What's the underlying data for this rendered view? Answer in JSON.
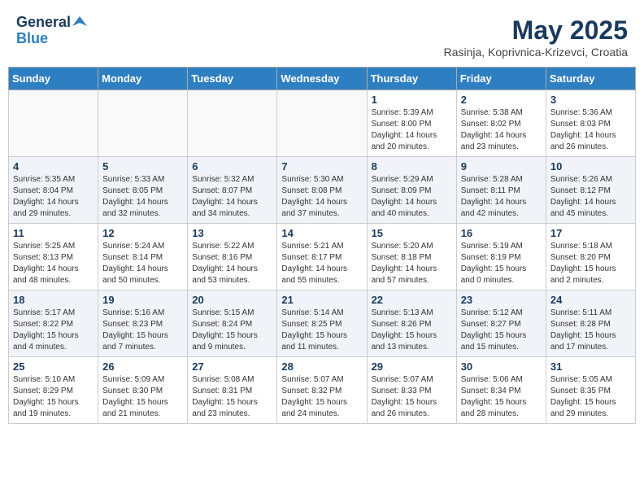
{
  "header": {
    "logo_general": "General",
    "logo_blue": "Blue",
    "month_title": "May 2025",
    "location": "Rasinja, Koprivnica-Krizevci, Croatia"
  },
  "weekdays": [
    "Sunday",
    "Monday",
    "Tuesday",
    "Wednesday",
    "Thursday",
    "Friday",
    "Saturday"
  ],
  "weeks": [
    [
      {
        "day": "",
        "info": ""
      },
      {
        "day": "",
        "info": ""
      },
      {
        "day": "",
        "info": ""
      },
      {
        "day": "",
        "info": ""
      },
      {
        "day": "1",
        "info": "Sunrise: 5:39 AM\nSunset: 8:00 PM\nDaylight: 14 hours\nand 20 minutes."
      },
      {
        "day": "2",
        "info": "Sunrise: 5:38 AM\nSunset: 8:02 PM\nDaylight: 14 hours\nand 23 minutes."
      },
      {
        "day": "3",
        "info": "Sunrise: 5:36 AM\nSunset: 8:03 PM\nDaylight: 14 hours\nand 26 minutes."
      }
    ],
    [
      {
        "day": "4",
        "info": "Sunrise: 5:35 AM\nSunset: 8:04 PM\nDaylight: 14 hours\nand 29 minutes."
      },
      {
        "day": "5",
        "info": "Sunrise: 5:33 AM\nSunset: 8:05 PM\nDaylight: 14 hours\nand 32 minutes."
      },
      {
        "day": "6",
        "info": "Sunrise: 5:32 AM\nSunset: 8:07 PM\nDaylight: 14 hours\nand 34 minutes."
      },
      {
        "day": "7",
        "info": "Sunrise: 5:30 AM\nSunset: 8:08 PM\nDaylight: 14 hours\nand 37 minutes."
      },
      {
        "day": "8",
        "info": "Sunrise: 5:29 AM\nSunset: 8:09 PM\nDaylight: 14 hours\nand 40 minutes."
      },
      {
        "day": "9",
        "info": "Sunrise: 5:28 AM\nSunset: 8:11 PM\nDaylight: 14 hours\nand 42 minutes."
      },
      {
        "day": "10",
        "info": "Sunrise: 5:26 AM\nSunset: 8:12 PM\nDaylight: 14 hours\nand 45 minutes."
      }
    ],
    [
      {
        "day": "11",
        "info": "Sunrise: 5:25 AM\nSunset: 8:13 PM\nDaylight: 14 hours\nand 48 minutes."
      },
      {
        "day": "12",
        "info": "Sunrise: 5:24 AM\nSunset: 8:14 PM\nDaylight: 14 hours\nand 50 minutes."
      },
      {
        "day": "13",
        "info": "Sunrise: 5:22 AM\nSunset: 8:16 PM\nDaylight: 14 hours\nand 53 minutes."
      },
      {
        "day": "14",
        "info": "Sunrise: 5:21 AM\nSunset: 8:17 PM\nDaylight: 14 hours\nand 55 minutes."
      },
      {
        "day": "15",
        "info": "Sunrise: 5:20 AM\nSunset: 8:18 PM\nDaylight: 14 hours\nand 57 minutes."
      },
      {
        "day": "16",
        "info": "Sunrise: 5:19 AM\nSunset: 8:19 PM\nDaylight: 15 hours\nand 0 minutes."
      },
      {
        "day": "17",
        "info": "Sunrise: 5:18 AM\nSunset: 8:20 PM\nDaylight: 15 hours\nand 2 minutes."
      }
    ],
    [
      {
        "day": "18",
        "info": "Sunrise: 5:17 AM\nSunset: 8:22 PM\nDaylight: 15 hours\nand 4 minutes."
      },
      {
        "day": "19",
        "info": "Sunrise: 5:16 AM\nSunset: 8:23 PM\nDaylight: 15 hours\nand 7 minutes."
      },
      {
        "day": "20",
        "info": "Sunrise: 5:15 AM\nSunset: 8:24 PM\nDaylight: 15 hours\nand 9 minutes."
      },
      {
        "day": "21",
        "info": "Sunrise: 5:14 AM\nSunset: 8:25 PM\nDaylight: 15 hours\nand 11 minutes."
      },
      {
        "day": "22",
        "info": "Sunrise: 5:13 AM\nSunset: 8:26 PM\nDaylight: 15 hours\nand 13 minutes."
      },
      {
        "day": "23",
        "info": "Sunrise: 5:12 AM\nSunset: 8:27 PM\nDaylight: 15 hours\nand 15 minutes."
      },
      {
        "day": "24",
        "info": "Sunrise: 5:11 AM\nSunset: 8:28 PM\nDaylight: 15 hours\nand 17 minutes."
      }
    ],
    [
      {
        "day": "25",
        "info": "Sunrise: 5:10 AM\nSunset: 8:29 PM\nDaylight: 15 hours\nand 19 minutes."
      },
      {
        "day": "26",
        "info": "Sunrise: 5:09 AM\nSunset: 8:30 PM\nDaylight: 15 hours\nand 21 minutes."
      },
      {
        "day": "27",
        "info": "Sunrise: 5:08 AM\nSunset: 8:31 PM\nDaylight: 15 hours\nand 23 minutes."
      },
      {
        "day": "28",
        "info": "Sunrise: 5:07 AM\nSunset: 8:32 PM\nDaylight: 15 hours\nand 24 minutes."
      },
      {
        "day": "29",
        "info": "Sunrise: 5:07 AM\nSunset: 8:33 PM\nDaylight: 15 hours\nand 26 minutes."
      },
      {
        "day": "30",
        "info": "Sunrise: 5:06 AM\nSunset: 8:34 PM\nDaylight: 15 hours\nand 28 minutes."
      },
      {
        "day": "31",
        "info": "Sunrise: 5:05 AM\nSunset: 8:35 PM\nDaylight: 15 hours\nand 29 minutes."
      }
    ]
  ]
}
